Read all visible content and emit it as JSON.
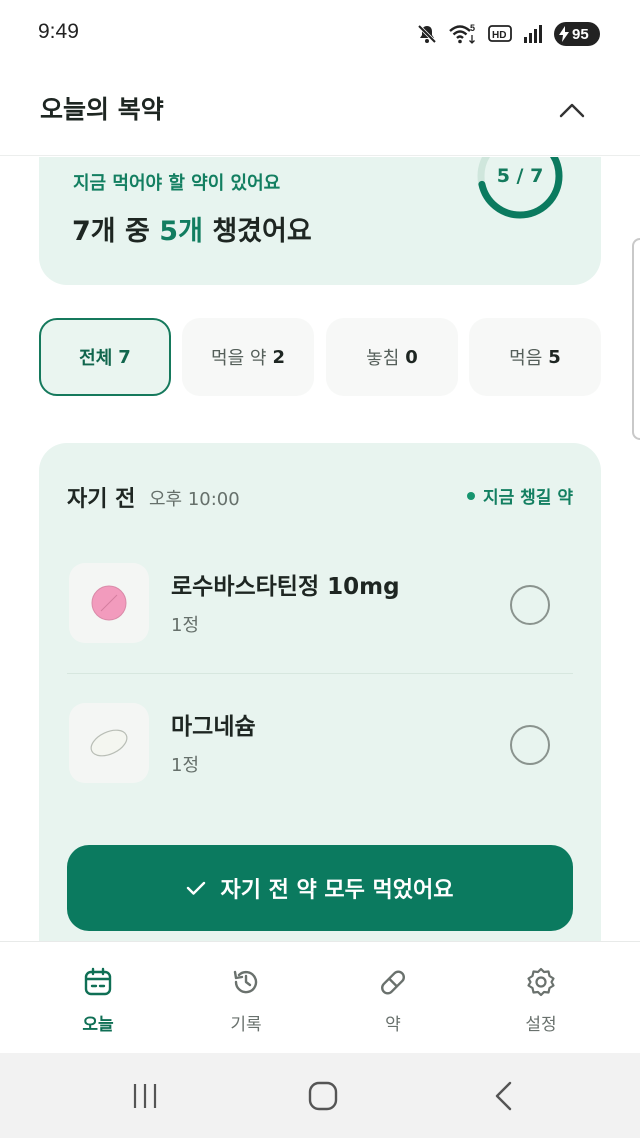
{
  "status_bar": {
    "time": "9:49",
    "wifi_badge": "5",
    "hd_badge": "HD",
    "battery": "95"
  },
  "header": {
    "title": "오늘의 복약"
  },
  "summary": {
    "alert": "지금 먹어야 할 약이 있어요",
    "count_prefix": "7개 중 ",
    "count_accent": "5개",
    "count_suffix": " 챙겼어요",
    "progress_label": "5 / 7",
    "taken": 5,
    "total": 7
  },
  "filters": [
    {
      "label": "전체",
      "count": "7",
      "active": true
    },
    {
      "label": "먹을 약",
      "count": "2",
      "active": false
    },
    {
      "label": "놓침",
      "count": "0",
      "active": false
    },
    {
      "label": "먹음",
      "count": "5",
      "active": false
    }
  ],
  "dose": {
    "title": "자기 전",
    "time": "오후 10:00",
    "badge": "지금 챙길 약",
    "medications": [
      {
        "name": "로수바스타틴정 10mg",
        "qty": "1정",
        "pill_color": "#f29bbd"
      },
      {
        "name": "마그네슘",
        "qty": "1정",
        "pill_color": "#f4f6f0"
      }
    ],
    "take_all_label": "자기 전 약 모두 먹었어요"
  },
  "bottom_nav": [
    {
      "label": "오늘",
      "icon": "calendar-icon",
      "active": true
    },
    {
      "label": "기록",
      "icon": "history-icon",
      "active": false
    },
    {
      "label": "약",
      "icon": "pill-icon",
      "active": false
    },
    {
      "label": "설정",
      "icon": "gear-icon",
      "active": false
    }
  ],
  "colors": {
    "primary": "#0b7a5f",
    "accent_text": "#137f61",
    "card_bg": "#e8f4ef"
  }
}
